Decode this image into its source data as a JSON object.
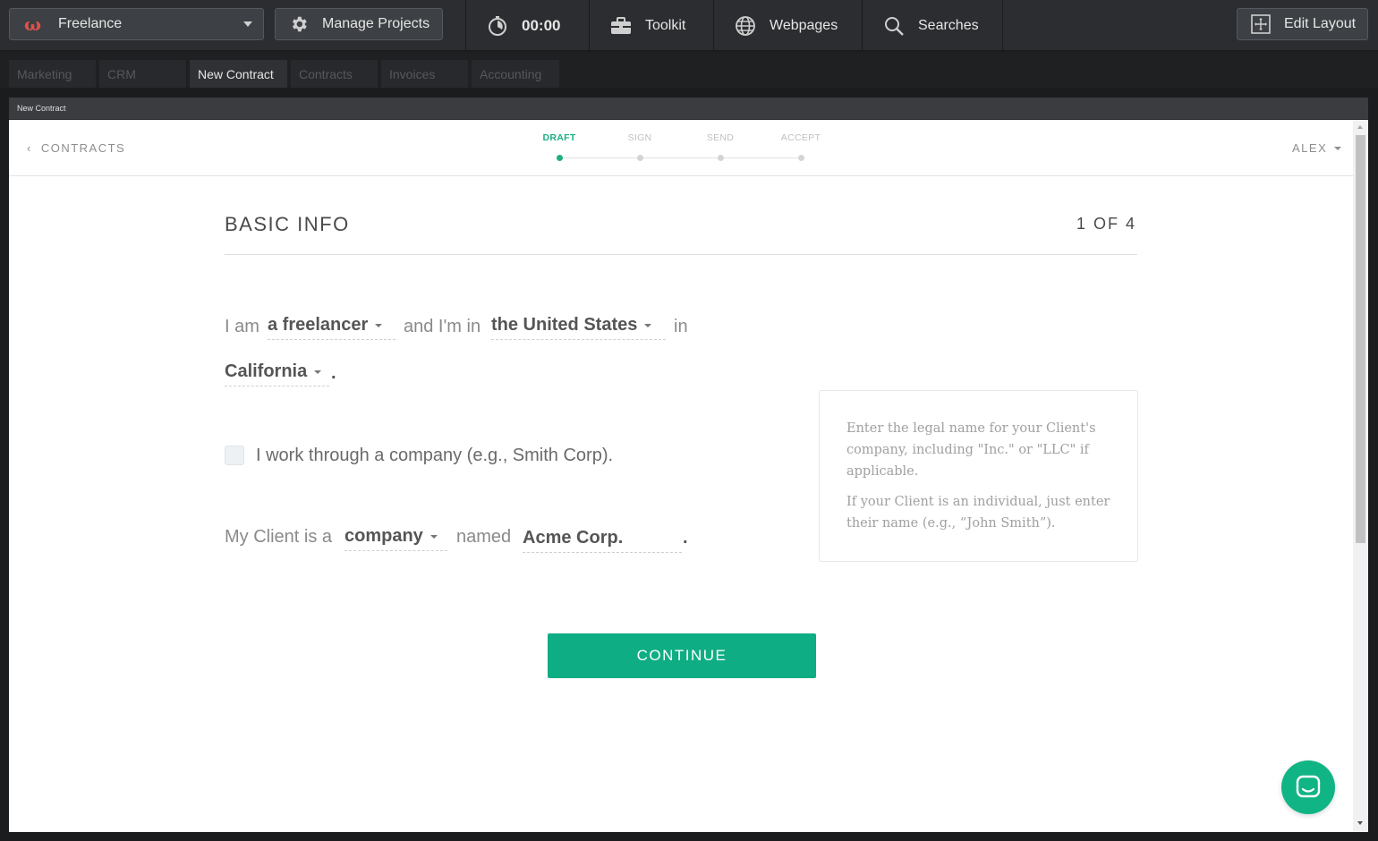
{
  "topbar": {
    "workspace": "Freelance",
    "manage_projects": "Manage Projects",
    "timer": "00:00",
    "toolkit": "Toolkit",
    "webpages": "Webpages",
    "searches": "Searches",
    "edit_layout": "Edit Layout"
  },
  "tabs": [
    "Marketing",
    "CRM",
    "New Contract",
    "Contracts",
    "Invoices",
    "Accounting"
  ],
  "active_tab": "New Contract",
  "panel": {
    "title": "New Contract"
  },
  "app": {
    "back_link": "CONTRACTS",
    "user": "ALEX",
    "steps": [
      "DRAFT",
      "SIGN",
      "SEND",
      "ACCEPT"
    ],
    "active_step": "DRAFT"
  },
  "form": {
    "section_title": "BASIC INFO",
    "section_count": "1 OF 4",
    "i_am": "I am",
    "role": "a freelancer",
    "and_im_in": "and I'm in",
    "country": "the United States",
    "in": "in",
    "state": "California",
    "period": ".",
    "company_checkbox_label": "I work through a company (e.g., Smith Corp).",
    "company_checkbox_checked": false,
    "client_is_a": "My Client is a",
    "client_type": "company",
    "named": "named",
    "client_name": "Acme Corp.",
    "continue_label": "CONTINUE"
  },
  "help": {
    "paragraph1": "Enter the legal name for your Client's company, including \"Inc.\" or \"LLC\" if applicable.",
    "paragraph2": "If your Client is an individual, just enter their name (e.g., “John Smith”)."
  },
  "colors": {
    "accent": "#0fad83",
    "brand_logo": "#e4504a",
    "topbar_bg": "#2b2d30"
  }
}
